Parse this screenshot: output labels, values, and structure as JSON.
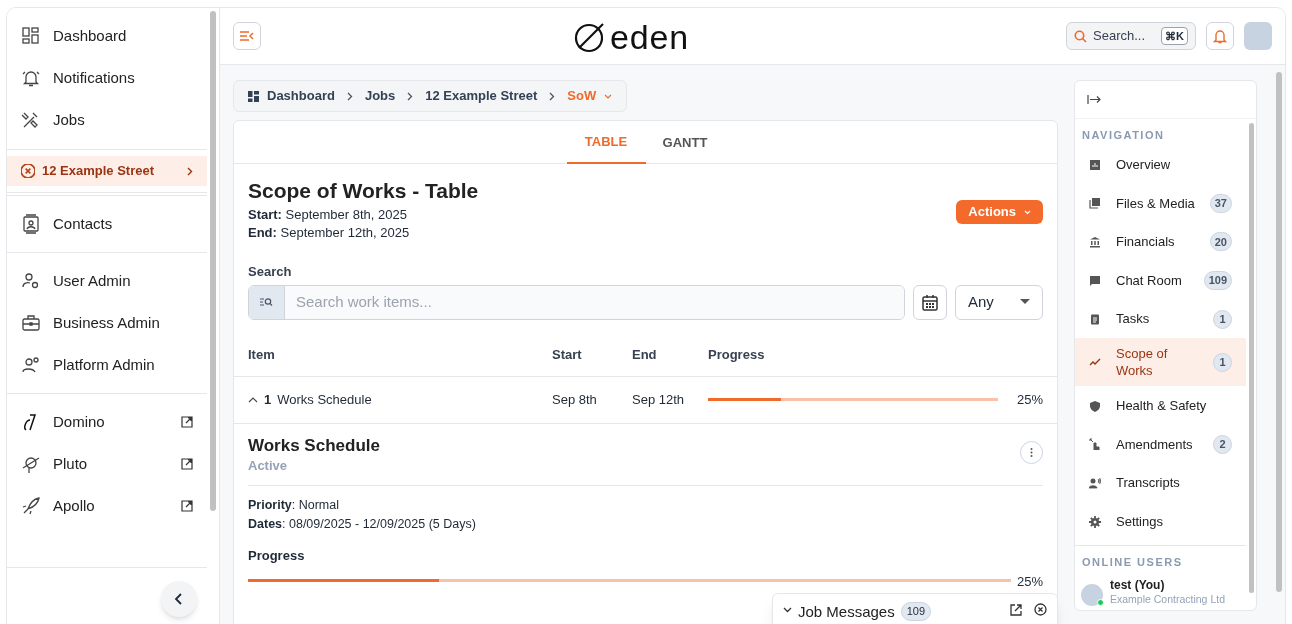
{
  "sidebar": {
    "sections": [
      {
        "items": [
          {
            "label": "Dashboard",
            "kind": "link",
            "selected": false
          },
          {
            "label": "Notifications",
            "kind": "link",
            "selected": false
          },
          {
            "label": "Jobs",
            "kind": "link",
            "selected": false
          }
        ]
      },
      {
        "items": [
          {
            "label": "12 Example Street",
            "kind": "job",
            "selected": true
          }
        ]
      },
      {
        "items": [
          {
            "label": "Contacts",
            "kind": "link",
            "selected": false
          }
        ]
      },
      {
        "items": [
          {
            "label": "User Admin",
            "kind": "link",
            "selected": false
          },
          {
            "label": "Business Admin",
            "kind": "link",
            "selected": false
          },
          {
            "label": "Platform Admin",
            "kind": "link",
            "selected": false
          }
        ]
      },
      {
        "items": [
          {
            "label": "Domino",
            "kind": "external",
            "selected": false
          },
          {
            "label": "Pluto",
            "kind": "external",
            "selected": false
          },
          {
            "label": "Apollo",
            "kind": "external",
            "selected": false
          }
        ]
      }
    ]
  },
  "header": {
    "logo": "eden",
    "search": {
      "placeholder": "Search...",
      "shortcut": "⌘K"
    }
  },
  "breadcrumb": [
    {
      "label": "Dashboard",
      "selected": false
    },
    {
      "label": "Jobs",
      "selected": false
    },
    {
      "label": "12 Example Street",
      "selected": false
    },
    {
      "label": "SoW",
      "selected": true
    }
  ],
  "tabs": [
    {
      "label": "TABLE",
      "selected": true
    },
    {
      "label": "GANTT",
      "selected": false
    }
  ],
  "page": {
    "title": "Scope of Works - Table",
    "start": "**Start:** September 8th, 2025",
    "end": "**End:** September 12th, 2025",
    "actions_button": "Actions"
  },
  "search": {
    "label": "Search",
    "placeholder": "Search work items...",
    "filter": "Any"
  },
  "table": {
    "columns": [
      "Item",
      "Start",
      "End",
      "Progress"
    ],
    "rows": [
      {
        "number": "1",
        "name": "Works Schedule",
        "start": "Sep 8th",
        "end": "Sep 12th",
        "level": 0.25,
        "reading": "25%",
        "expanded": true
      }
    ]
  },
  "detail": {
    "title": "Works Schedule",
    "status": "Active",
    "lines": [
      "**Priority**: Normal",
      "**Dates**: 08/09/2025 - 12/09/2025 (5 Days)"
    ],
    "progress_label": "Progress",
    "level": 0.25,
    "reading": "25%"
  },
  "right_panel": {
    "heading": "NAVIGATION",
    "items": [
      {
        "label": "Overview",
        "selected": false
      },
      {
        "label": "Files & Media",
        "count": "37",
        "selected": false
      },
      {
        "label": "Financials",
        "count": "20",
        "selected": false
      },
      {
        "label": "Chat Room",
        "count": "109",
        "selected": false
      },
      {
        "label": "Tasks",
        "count": "1",
        "selected": false
      },
      {
        "label": "Scope of Works",
        "count": "1",
        "selected": true
      },
      {
        "label": "Health & Safety",
        "selected": false
      },
      {
        "label": "Amendments",
        "count": "2",
        "selected": false
      },
      {
        "label": "Transcripts",
        "selected": false
      },
      {
        "label": "Settings",
        "selected": false
      }
    ],
    "users_heading": "ONLINE USERS",
    "users": [
      {
        "name": "test (You)",
        "company": "Example Contracting Ltd",
        "online": true
      }
    ]
  },
  "chat": {
    "title": "Job Messages",
    "count": "109"
  }
}
